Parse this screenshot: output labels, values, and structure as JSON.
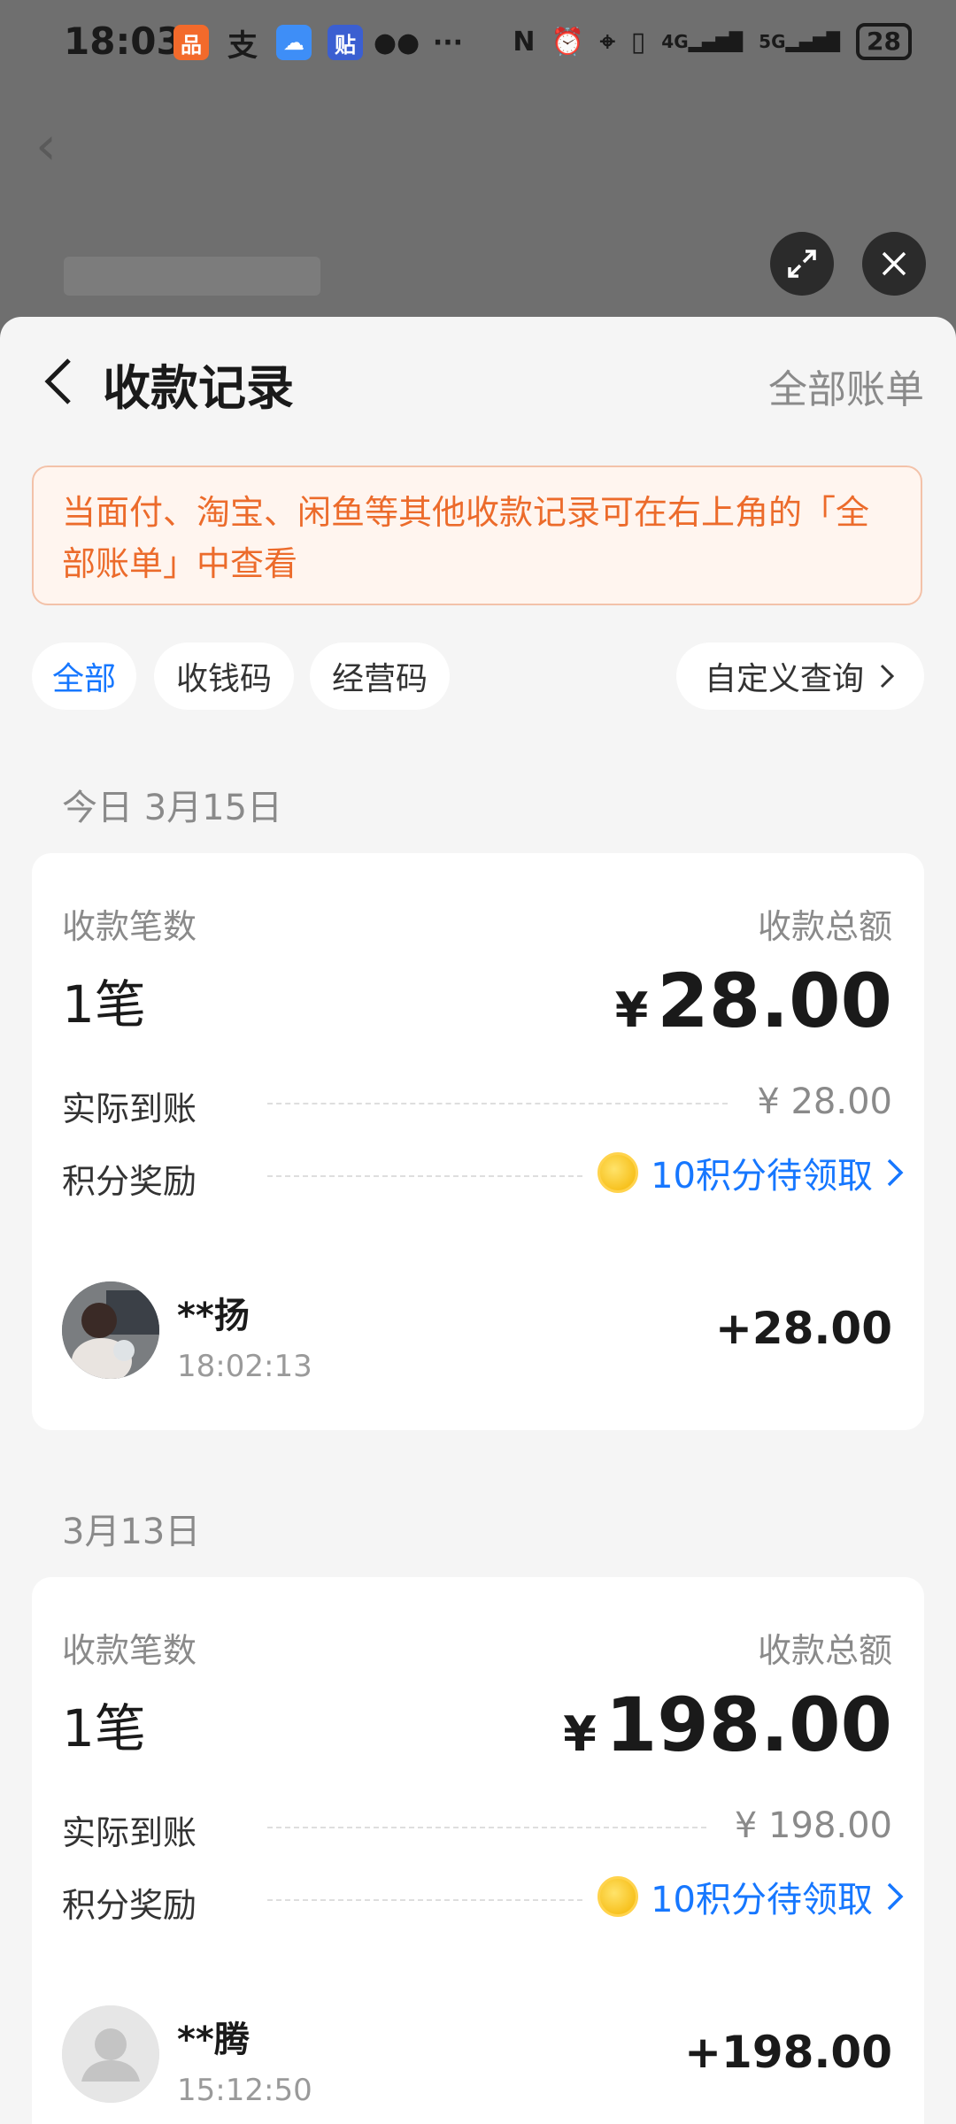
{
  "status_bar": {
    "time": "18:03",
    "left_icons": [
      "app-icon-1",
      "alipay-icon",
      "weather-icon",
      "tieba-icon",
      "wechat-icon",
      "more-dots"
    ],
    "right_icons": [
      "nfc-icon",
      "alarm-icon",
      "location-icon",
      "vibrate-icon",
      "signal-4g-icon",
      "signal-5g-icon"
    ],
    "signal_4g": "4G",
    "signal_5g": "5G",
    "battery": "28"
  },
  "header": {
    "title": "收款记录",
    "all_bills": "全部账单"
  },
  "notice": {
    "text": "当面付、淘宝、闲鱼等其他收款记录可在右上角的「全部账单」中查看"
  },
  "filters": {
    "chips": [
      "全部",
      "收钱码",
      "经营码"
    ],
    "active": "全部",
    "custom_query": "自定义查询"
  },
  "groups": [
    {
      "date": "今日 3月15日",
      "count_label": "收款笔数",
      "count": "1笔",
      "total_label": "收款总额",
      "currency": "¥",
      "total": "28.00",
      "actual_label": "实际到账",
      "actual_value": "¥ 28.00",
      "reward_label": "积分奖励",
      "reward_value": "10积分待领取",
      "payer": {
        "name": "**扬",
        "time": "18:02:13",
        "amount": "+28.00"
      }
    },
    {
      "date": "3月13日",
      "count_label": "收款笔数",
      "count": "1笔",
      "total_label": "收款总额",
      "currency": "¥",
      "total": "198.00",
      "actual_label": "实际到账",
      "actual_value": "¥ 198.00",
      "reward_label": "积分奖励",
      "reward_value": "10积分待领取",
      "payer": {
        "name": "**腾",
        "time": "15:12:50",
        "amount": "+198.00"
      }
    }
  ],
  "colors": {
    "accent": "#1677ff",
    "notice_text": "#ec6b2b",
    "notice_bg": "#fff5ef"
  }
}
